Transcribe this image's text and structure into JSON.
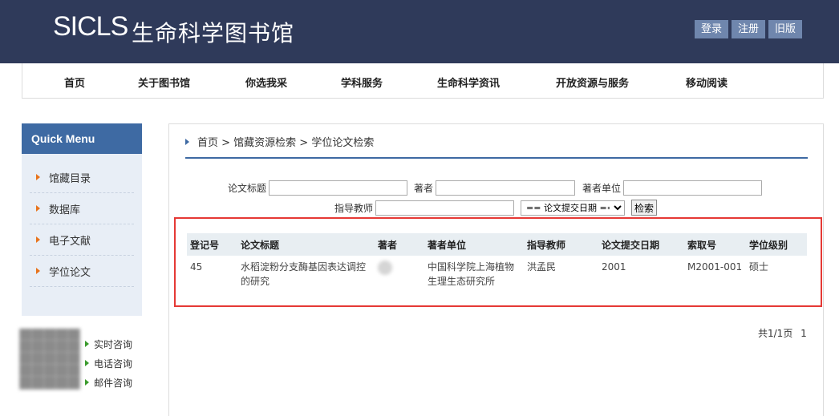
{
  "header": {
    "logo": "SICLS",
    "title": "生命科学图书馆",
    "buttons": [
      "登录",
      "注册",
      "旧版"
    ]
  },
  "nav": [
    "首页",
    "关于图书馆",
    "你选我采",
    "学科服务",
    "生命科学资讯",
    "开放资源与服务",
    "移动阅读"
  ],
  "quick_menu": {
    "title": "Quick Menu",
    "items": [
      "馆藏目录",
      "数据库",
      "电子文献",
      "学位论文"
    ]
  },
  "consult": [
    "实时咨询",
    "电话咨询",
    "邮件咨询"
  ],
  "breadcrumb": "首页 > 馆藏资源检索 > 学位论文检索",
  "search_form": {
    "title_label": "论文标题",
    "title_value": "",
    "author_label": "著者",
    "author_value": "",
    "unit_label": "著者单位",
    "unit_value": "",
    "advisor_label": "指导教师",
    "advisor_value": "",
    "date_select": "== 论文提交日期 ==",
    "search_button": "检索"
  },
  "table": {
    "headers": [
      "登记号",
      "论文标题",
      "著者",
      "著者单位",
      "指导教师",
      "论文提交日期",
      "索取号",
      "学位级别"
    ],
    "rows": [
      {
        "reg_no": "45",
        "title": "水稻淀粉分支酶基因表达调控的研究",
        "author": "",
        "unit": "中国科学院上海植物生理生态研究所",
        "advisor": "洪孟民",
        "date": "2001",
        "call_no": "M2001-001",
        "degree": "硕士"
      }
    ]
  },
  "pager": {
    "summary": "共1/1页",
    "page": "1"
  }
}
